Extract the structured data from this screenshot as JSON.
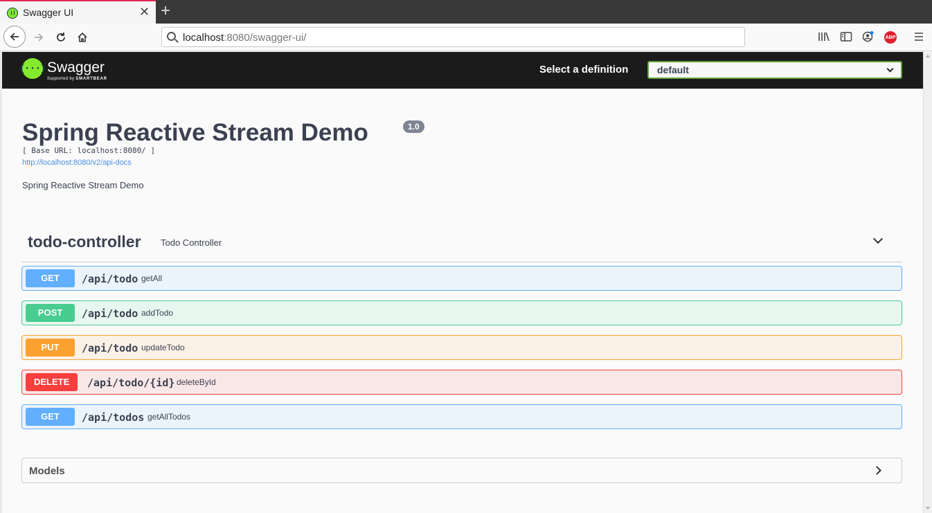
{
  "browser": {
    "tab_title": "Swagger UI",
    "tab_close": "✕",
    "new_tab": "+",
    "url_host": "localhost",
    "url_rest": ":8080/swagger-ui/",
    "abp_label": "ABP"
  },
  "topbar": {
    "brand": "Swagger",
    "brand_sub_prefix": "Supported by",
    "brand_sub_company": "SMARTBEAR",
    "select_label": "Select a definition",
    "select_value": "default"
  },
  "info": {
    "title": "Spring Reactive Stream Demo",
    "version": "1.0",
    "base_url": "[ Base URL: localhost:8080/ ]",
    "api_docs_link": "http://localhost:8080/v2/api-docs",
    "description": "Spring Reactive Stream Demo"
  },
  "tag": {
    "name": "todo-controller",
    "description": "Todo Controller"
  },
  "operations": [
    {
      "method": "GET",
      "path": "/api/todo",
      "summary": "getAll"
    },
    {
      "method": "POST",
      "path": "/api/todo",
      "summary": "addTodo"
    },
    {
      "method": "PUT",
      "path": "/api/todo",
      "summary": "updateTodo"
    },
    {
      "method": "DELETE",
      "path": "/api/todo/{id}",
      "summary": "deleteById"
    },
    {
      "method": "GET",
      "path": "/api/todos",
      "summary": "getAllTodos"
    }
  ],
  "models": {
    "label": "Models"
  },
  "colors": {
    "get": "#61affe",
    "post": "#49cc90",
    "put": "#fca130",
    "delete": "#f93e3e",
    "swagger_green": "#85ea2d"
  }
}
